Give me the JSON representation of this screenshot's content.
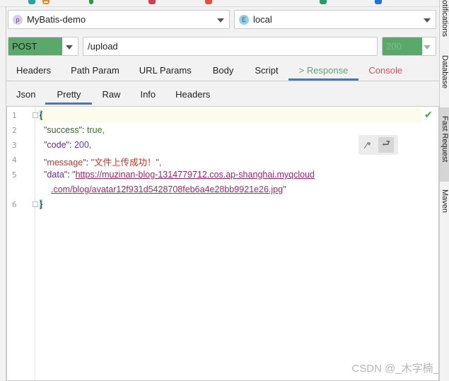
{
  "project": {
    "badge": "p",
    "name": "MyBatis-demo"
  },
  "env": {
    "badge": "E",
    "name": "local"
  },
  "request": {
    "method": "POST",
    "url": "/upload",
    "status": "200"
  },
  "main_tabs": [
    {
      "label": "Headers"
    },
    {
      "label": "Path Param"
    },
    {
      "label": "URL Params"
    },
    {
      "label": "Body"
    },
    {
      "label": "Script"
    },
    {
      "label": "> Response"
    },
    {
      "label": "Console"
    }
  ],
  "sub_tabs": [
    {
      "label": "Json"
    },
    {
      "label": "Pretty"
    },
    {
      "label": "Raw"
    },
    {
      "label": "Info"
    },
    {
      "label": "Headers"
    }
  ],
  "right_bar": [
    "otifications",
    "Database",
    "Fast Request",
    "Maven"
  ],
  "editor": {
    "line_numbers": [
      "1",
      "2",
      "3",
      "4",
      "5",
      "6"
    ],
    "open_brace": "{",
    "close_brace": "}",
    "lines": [
      {
        "key": "\"success\"",
        "value": "true,"
      },
      {
        "key": "\"code\"",
        "value": "200,"
      },
      {
        "key": "\"message\"",
        "value": "\"文件上传成功！\","
      },
      {
        "key": "\"data\"",
        "value_prefix": "\"",
        "url_part1": "https://muzinan-blog-1314779712.cos.ap-shanghai.myqcloud",
        "url_part2": ".com/blog/avatar12f931d5428708feb6a4e28bb9921e26.jpg",
        "value_suffix": "\""
      }
    ]
  },
  "watermark": "CSDN @_木字楠_",
  "colors": {
    "accent": "#3d7cc4",
    "method": "#5aa86a",
    "response_tab": "#5aa86a",
    "console_tab": "#e0505a"
  }
}
